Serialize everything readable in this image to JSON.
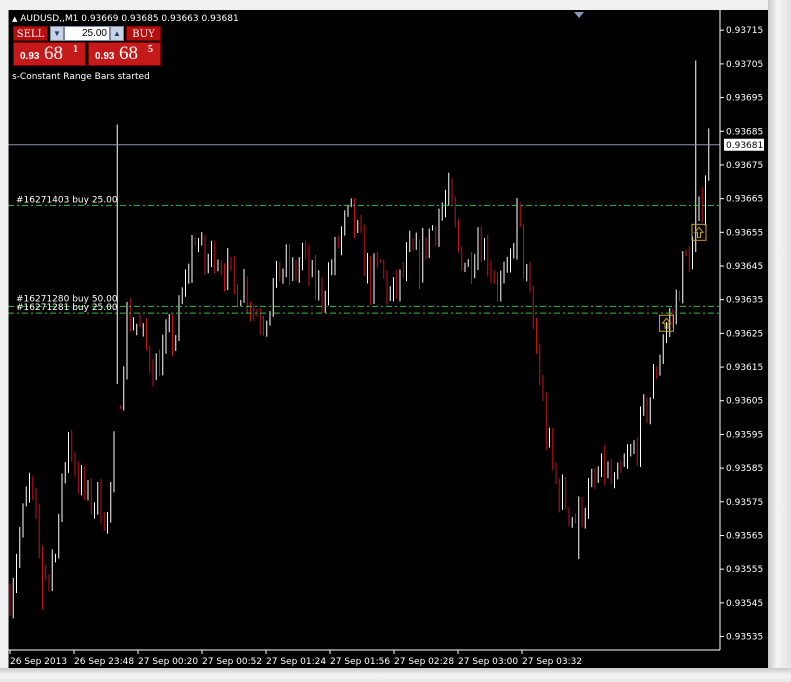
{
  "colors": {
    "background": "#000000",
    "bull_candle": "#ffffff",
    "bear_candle": "#c0121b",
    "trade_line": "#33c43a",
    "bid_line": "#8c96b4",
    "arrow_marker": "#c9a227",
    "sell_button": "#b50f0f"
  },
  "header": {
    "symbol_line": "AUDUSD,,M1  0.93669 0.93685 0.93663 0.93681"
  },
  "trade_panel": {
    "sell_label": "SELL",
    "buy_label": "BUY",
    "lot_value": "25.00",
    "sell_price_small": "0.93",
    "sell_price_big": "68",
    "sell_price_sup": "1",
    "buy_price_small": "0.93",
    "buy_price_big": "68",
    "buy_price_sup": "5",
    "lot_down_icon": "triangle-down",
    "lot_up_icon": "triangle-up"
  },
  "status_text": "s-Constant Range Bars started",
  "order_labels": [
    "#16271403 buy 25.00",
    "#16271280 buy 50.00",
    "#16271281 buy 25.00"
  ],
  "price_axis": {
    "ticks": [
      "0.93715",
      "0.93705",
      "0.93695",
      "0.93685",
      "0.93675",
      "0.93665",
      "0.93655",
      "0.93645",
      "0.93635",
      "0.93625",
      "0.93615",
      "0.93605",
      "0.93595",
      "0.93585",
      "0.93575",
      "0.93565",
      "0.93555",
      "0.93545",
      "0.93535"
    ],
    "current_price": "0.93681"
  },
  "time_axis": {
    "ticks": [
      "26 Sep 2013",
      "26 Sep 23:48",
      "27 Sep 00:20",
      "27 Sep 00:52",
      "27 Sep 01:24",
      "27 Sep 01:56",
      "27 Sep 02:28",
      "27 Sep 03:00",
      "27 Sep 03:32"
    ]
  },
  "chart_data": {
    "type": "candlestick",
    "symbol": "AUDUSD",
    "timeframe": "M1",
    "ylim": [
      0.93531,
      0.93721
    ],
    "current_bid": 0.93681,
    "order_levels": [
      {
        "label": "#16271403 buy 25.00",
        "price": 0.93663
      },
      {
        "label": "#16271280 buy 50.00",
        "price": 0.93633
      },
      {
        "label": "#16271281 buy 25.00",
        "price": 0.93631
      }
    ],
    "buy_arrows": [
      {
        "bar_index": 202,
        "price": 0.93628
      },
      {
        "bar_index": 212,
        "price": 0.93655
      }
    ],
    "close_path": [
      [
        0,
        0.93548
      ],
      [
        3,
        0.93565
      ],
      [
        6,
        0.9358
      ],
      [
        9,
        0.9356
      ],
      [
        12,
        0.93552
      ],
      [
        15,
        0.9357
      ],
      [
        18,
        0.93595
      ],
      [
        21,
        0.93582
      ],
      [
        24,
        0.93575
      ],
      [
        27,
        0.93576
      ],
      [
        30,
        0.9357
      ],
      [
        33,
        0.93598
      ],
      [
        36,
        0.9363
      ],
      [
        39,
        0.93628
      ],
      [
        42,
        0.9362
      ],
      [
        45,
        0.93615
      ],
      [
        48,
        0.93622
      ],
      [
        51,
        0.93625
      ],
      [
        54,
        0.9364
      ],
      [
        57,
        0.93655
      ],
      [
        60,
        0.93645
      ],
      [
        63,
        0.9365
      ],
      [
        66,
        0.93645
      ],
      [
        69,
        0.93638
      ],
      [
        72,
        0.9364
      ],
      [
        75,
        0.93632
      ],
      [
        78,
        0.9363
      ],
      [
        81,
        0.93638
      ],
      [
        84,
        0.93645
      ],
      [
        87,
        0.93642
      ],
      [
        90,
        0.93648
      ],
      [
        93,
        0.9364
      ],
      [
        96,
        0.93637
      ],
      [
        99,
        0.93645
      ],
      [
        102,
        0.93655
      ],
      [
        105,
        0.9366
      ],
      [
        108,
        0.9365
      ],
      [
        111,
        0.9364
      ],
      [
        114,
        0.93645
      ],
      [
        117,
        0.93635
      ],
      [
        120,
        0.9364
      ],
      [
        123,
        0.93648
      ],
      [
        126,
        0.93646
      ],
      [
        129,
        0.93655
      ],
      [
        132,
        0.9366
      ],
      [
        135,
        0.93665
      ],
      [
        138,
        0.9365
      ],
      [
        141,
        0.93645
      ],
      [
        144,
        0.93655
      ],
      [
        147,
        0.93648
      ],
      [
        150,
        0.9364
      ],
      [
        153,
        0.9364
      ],
      [
        156,
        0.9366
      ],
      [
        159,
        0.9364
      ],
      [
        162,
        0.9362
      ],
      [
        165,
        0.93595
      ],
      [
        168,
        0.9358
      ],
      [
        171,
        0.93575
      ],
      [
        174,
        0.9357
      ],
      [
        177,
        0.93575
      ],
      [
        180,
        0.9358
      ],
      [
        183,
        0.93585
      ],
      [
        186,
        0.93578
      ],
      [
        189,
        0.93585
      ],
      [
        192,
        0.9359
      ],
      [
        195,
        0.936
      ],
      [
        198,
        0.9361
      ],
      [
        201,
        0.93625
      ],
      [
        204,
        0.9363
      ],
      [
        207,
        0.93645
      ],
      [
        210,
        0.9365
      ],
      [
        213,
        0.93665
      ],
      [
        215,
        0.93681
      ]
    ],
    "extremes": [
      {
        "bar_index": 33,
        "high": 0.93687,
        "low": 0.9361
      },
      {
        "bar_index": 10,
        "low": 0.93543
      },
      {
        "bar_index": 175,
        "low": 0.93558
      },
      {
        "bar_index": 211,
        "high": 0.93706
      }
    ]
  }
}
